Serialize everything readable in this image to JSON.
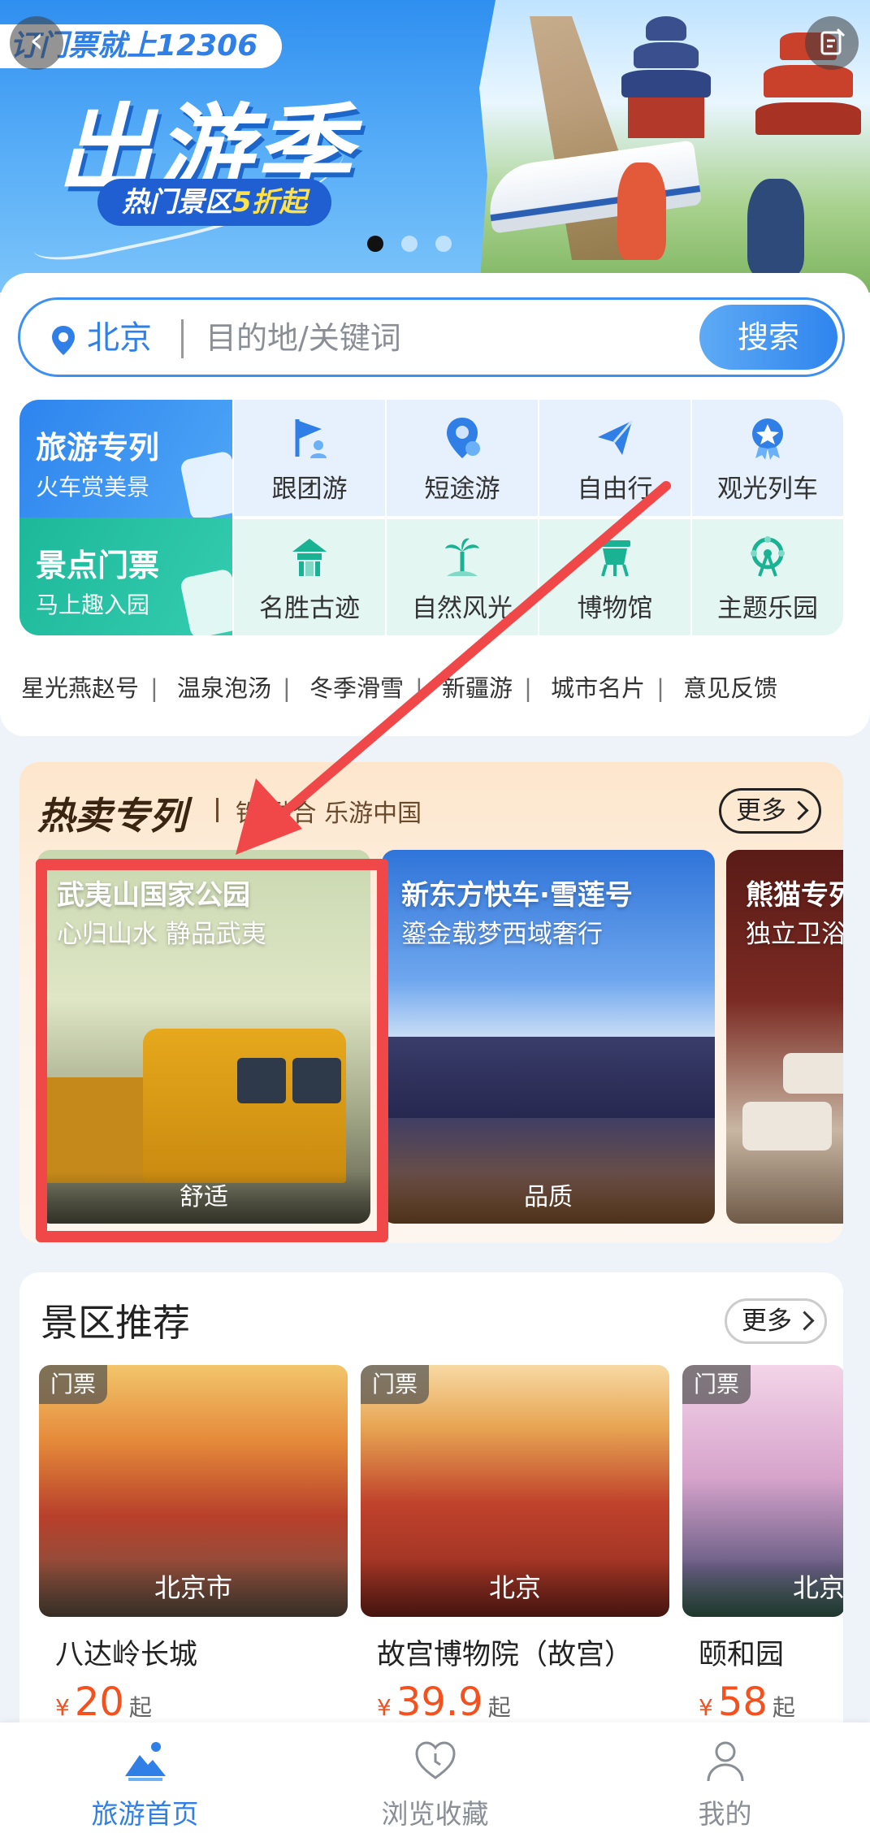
{
  "banner": {
    "slogan": "订门票就上12306",
    "title": "出游季",
    "subtitle_prefix": "热门景区",
    "subtitle_highlight": "5折起",
    "active_dot": 0,
    "dot_count": 3
  },
  "search": {
    "city": "北京",
    "placeholder": "目的地/关键词",
    "button": "搜索"
  },
  "categories": {
    "travel": {
      "title": "旅游专列",
      "subtitle": "火车赏美景"
    },
    "tickets": {
      "title": "景点门票",
      "subtitle": "马上趣入园"
    },
    "row1": [
      {
        "label": "跟团游",
        "icon": "group-flag-icon"
      },
      {
        "label": "短途游",
        "icon": "location-pin-icon"
      },
      {
        "label": "自由行",
        "icon": "paper-plane-icon"
      },
      {
        "label": "观光列车",
        "icon": "star-badge-icon"
      }
    ],
    "row2": [
      {
        "label": "名胜古迹",
        "icon": "pavilion-icon"
      },
      {
        "label": "自然风光",
        "icon": "palm-tree-icon"
      },
      {
        "label": "博物馆",
        "icon": "bronze-vessel-icon"
      },
      {
        "label": "主题乐园",
        "icon": "ferris-wheel-icon"
      }
    ]
  },
  "quick_links": [
    "星光燕赵号",
    "温泉泡汤",
    "冬季滑雪",
    "新疆游",
    "城市名片",
    "意见反馈"
  ],
  "hot": {
    "title": "热卖专列",
    "slogan": "铁 融合 乐游中国",
    "more": "更多",
    "routes": [
      {
        "name": "武夷山国家公园",
        "desc": "心归山水 静品武夷",
        "tag": "舒适"
      },
      {
        "name": "新东方快车·雪莲号",
        "desc": "鎏金载梦西域奢行",
        "tag": "品质"
      },
      {
        "name": "熊猫专列",
        "desc": "独立卫浴",
        "tag": ""
      }
    ]
  },
  "scenic": {
    "title": "景区推荐",
    "more": "更多",
    "spots": [
      {
        "badge": "门票",
        "location": "北京市",
        "name": "八达岭长城",
        "currency": "¥",
        "price": "20",
        "suffix": "起"
      },
      {
        "badge": "门票",
        "location": "北京",
        "name": "故宫博物院（故宫）",
        "currency": "¥",
        "price": "39.9",
        "suffix": "起"
      },
      {
        "badge": "门票",
        "location": "北京",
        "name": "颐和园",
        "currency": "¥",
        "price": "58",
        "suffix": "起"
      }
    ]
  },
  "tabbar": [
    {
      "label": "旅游首页",
      "icon": "mountain-sun-icon",
      "active": true
    },
    {
      "label": "浏览收藏",
      "icon": "heart-clock-icon",
      "active": false
    },
    {
      "label": "我的",
      "icon": "user-icon",
      "active": false
    }
  ],
  "colors": {
    "accent": "#2f7fe6",
    "highlight_frame": "#f04848",
    "price": "#f4511e"
  }
}
